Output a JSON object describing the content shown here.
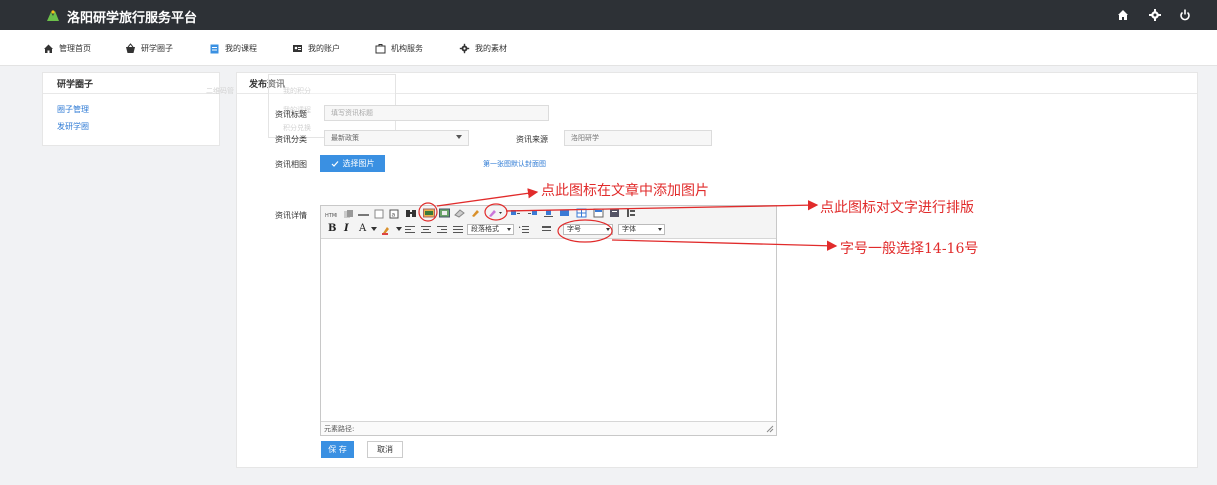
{
  "header": {
    "site_title": "洛阳研学旅行服务平台",
    "icons": [
      "home-icon",
      "gear-icon",
      "power-icon"
    ]
  },
  "nav": {
    "items": [
      {
        "label": "管理首页",
        "icon": "home-icon"
      },
      {
        "label": "研学圈子",
        "icon": "basket-icon"
      },
      {
        "label": "我的课程",
        "icon": "clipboard-icon"
      },
      {
        "label": "我的账户",
        "icon": "id-card-icon"
      },
      {
        "label": "机构服务",
        "icon": "briefcase-icon"
      },
      {
        "label": "我的素材",
        "icon": "gear-icon"
      }
    ]
  },
  "sidebar": {
    "title": "研学圈子",
    "links": [
      "圈子管理",
      "发研学圈"
    ]
  },
  "main": {
    "title": "发布资讯",
    "ghost": {
      "a": "我的积分",
      "b": "二维码管",
      "c": "我的课程",
      "d": "积分兑换"
    },
    "form": {
      "title_label": "资讯标题",
      "title_placeholder": "填写资讯标题",
      "category_label": "资讯分类",
      "category_value": "最新政策",
      "source_label": "资讯来源",
      "source_value": "洛阳研学",
      "thumb_label": "资讯相图",
      "thumb_button": "选择图片",
      "thumb_hint": "第一张图默认封面图",
      "detail_label": "资讯详情",
      "save_button": "保 存",
      "cancel_button": "取消"
    },
    "editor": {
      "format_select": "段落格式",
      "font_size_select": "字号",
      "font_family_select": "字体",
      "status_path": "元素路径:"
    }
  },
  "annotations": {
    "image_tip": "点此图标在文章中添加图片",
    "layout_tip": "点此图标对文字进行排版",
    "fontsize_tip": "字号一般选择14-16号"
  },
  "colors": {
    "topbar": "#2d3136",
    "primary": "#3a90e2",
    "link": "#2f7bd5",
    "annotation": "#e12b2b"
  }
}
